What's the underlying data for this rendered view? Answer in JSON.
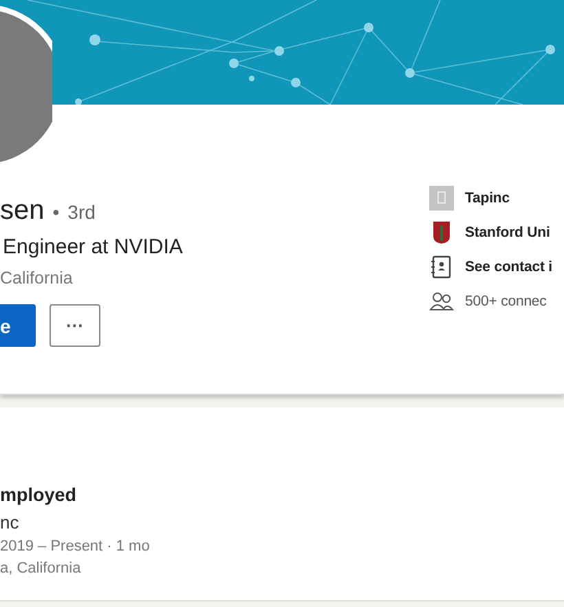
{
  "profile": {
    "name": "sen",
    "separator": "•",
    "degree": "3rd",
    "headline": "Engineer at NVIDIA",
    "location": "California",
    "primary_button": "e",
    "more_button": "···"
  },
  "highlights": [
    {
      "kind": "company",
      "text": "Tapinc"
    },
    {
      "kind": "school",
      "text": "Stanford Uni"
    },
    {
      "kind": "contact",
      "text": "See contact i"
    },
    {
      "kind": "connections",
      "text": "500+ connec"
    }
  ],
  "experience": {
    "title": "mployed",
    "company": "nc",
    "dates": "2019 – Present · 1 mo",
    "location": "a, California"
  }
}
